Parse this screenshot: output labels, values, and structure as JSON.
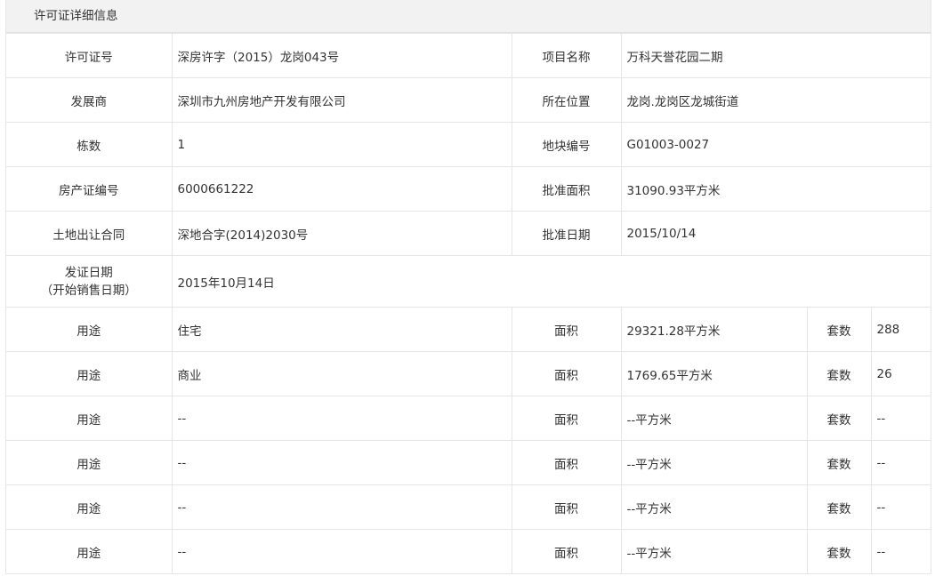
{
  "panel": {
    "title": "许可证详细信息"
  },
  "info": {
    "permit_no": {
      "label": "许可证号",
      "value": "深房许字（2015）龙岗043号"
    },
    "project_name": {
      "label": "项目名称",
      "value": "万科天誉花园二期"
    },
    "developer": {
      "label": "发展商",
      "value": "深圳市九州房地产开发有限公司"
    },
    "location": {
      "label": "所在位置",
      "value": "龙岗.龙岗区龙城街道"
    },
    "building_count": {
      "label": "栋数",
      "value": "1"
    },
    "parcel_no": {
      "label": "地块编号",
      "value": "G01003-0027"
    },
    "property_cert_no": {
      "label": "房产证编号",
      "value": "6000661222"
    },
    "approved_area": {
      "label": "批准面积",
      "value": "31090.93平方米"
    },
    "land_contract": {
      "label": "土地出让合同",
      "value": "深地合字(2014)2030号"
    },
    "approved_date": {
      "label": "批准日期",
      "value": "2015/10/14"
    },
    "issue_date": {
      "label_line1": "发证日期",
      "label_line2": "（开始销售日期）",
      "value": "2015年10月14日"
    }
  },
  "usage_rows": [
    {
      "usage_label": "用途",
      "usage": "住宅",
      "area_label": "面积",
      "area": "29321.28平方米",
      "units_label": "套数",
      "units": "288"
    },
    {
      "usage_label": "用途",
      "usage": "商业",
      "area_label": "面积",
      "area": "1769.65平方米",
      "units_label": "套数",
      "units": "26"
    },
    {
      "usage_label": "用途",
      "usage": "--",
      "area_label": "面积",
      "area": "--平方米",
      "units_label": "套数",
      "units": "--"
    },
    {
      "usage_label": "用途",
      "usage": "--",
      "area_label": "面积",
      "area": "--平方米",
      "units_label": "套数",
      "units": "--"
    },
    {
      "usage_label": "用途",
      "usage": "--",
      "area_label": "面积",
      "area": "--平方米",
      "units_label": "套数",
      "units": "--"
    },
    {
      "usage_label": "用途",
      "usage": "--",
      "area_label": "面积",
      "area": "--平方米",
      "units_label": "套数",
      "units": "--"
    }
  ]
}
